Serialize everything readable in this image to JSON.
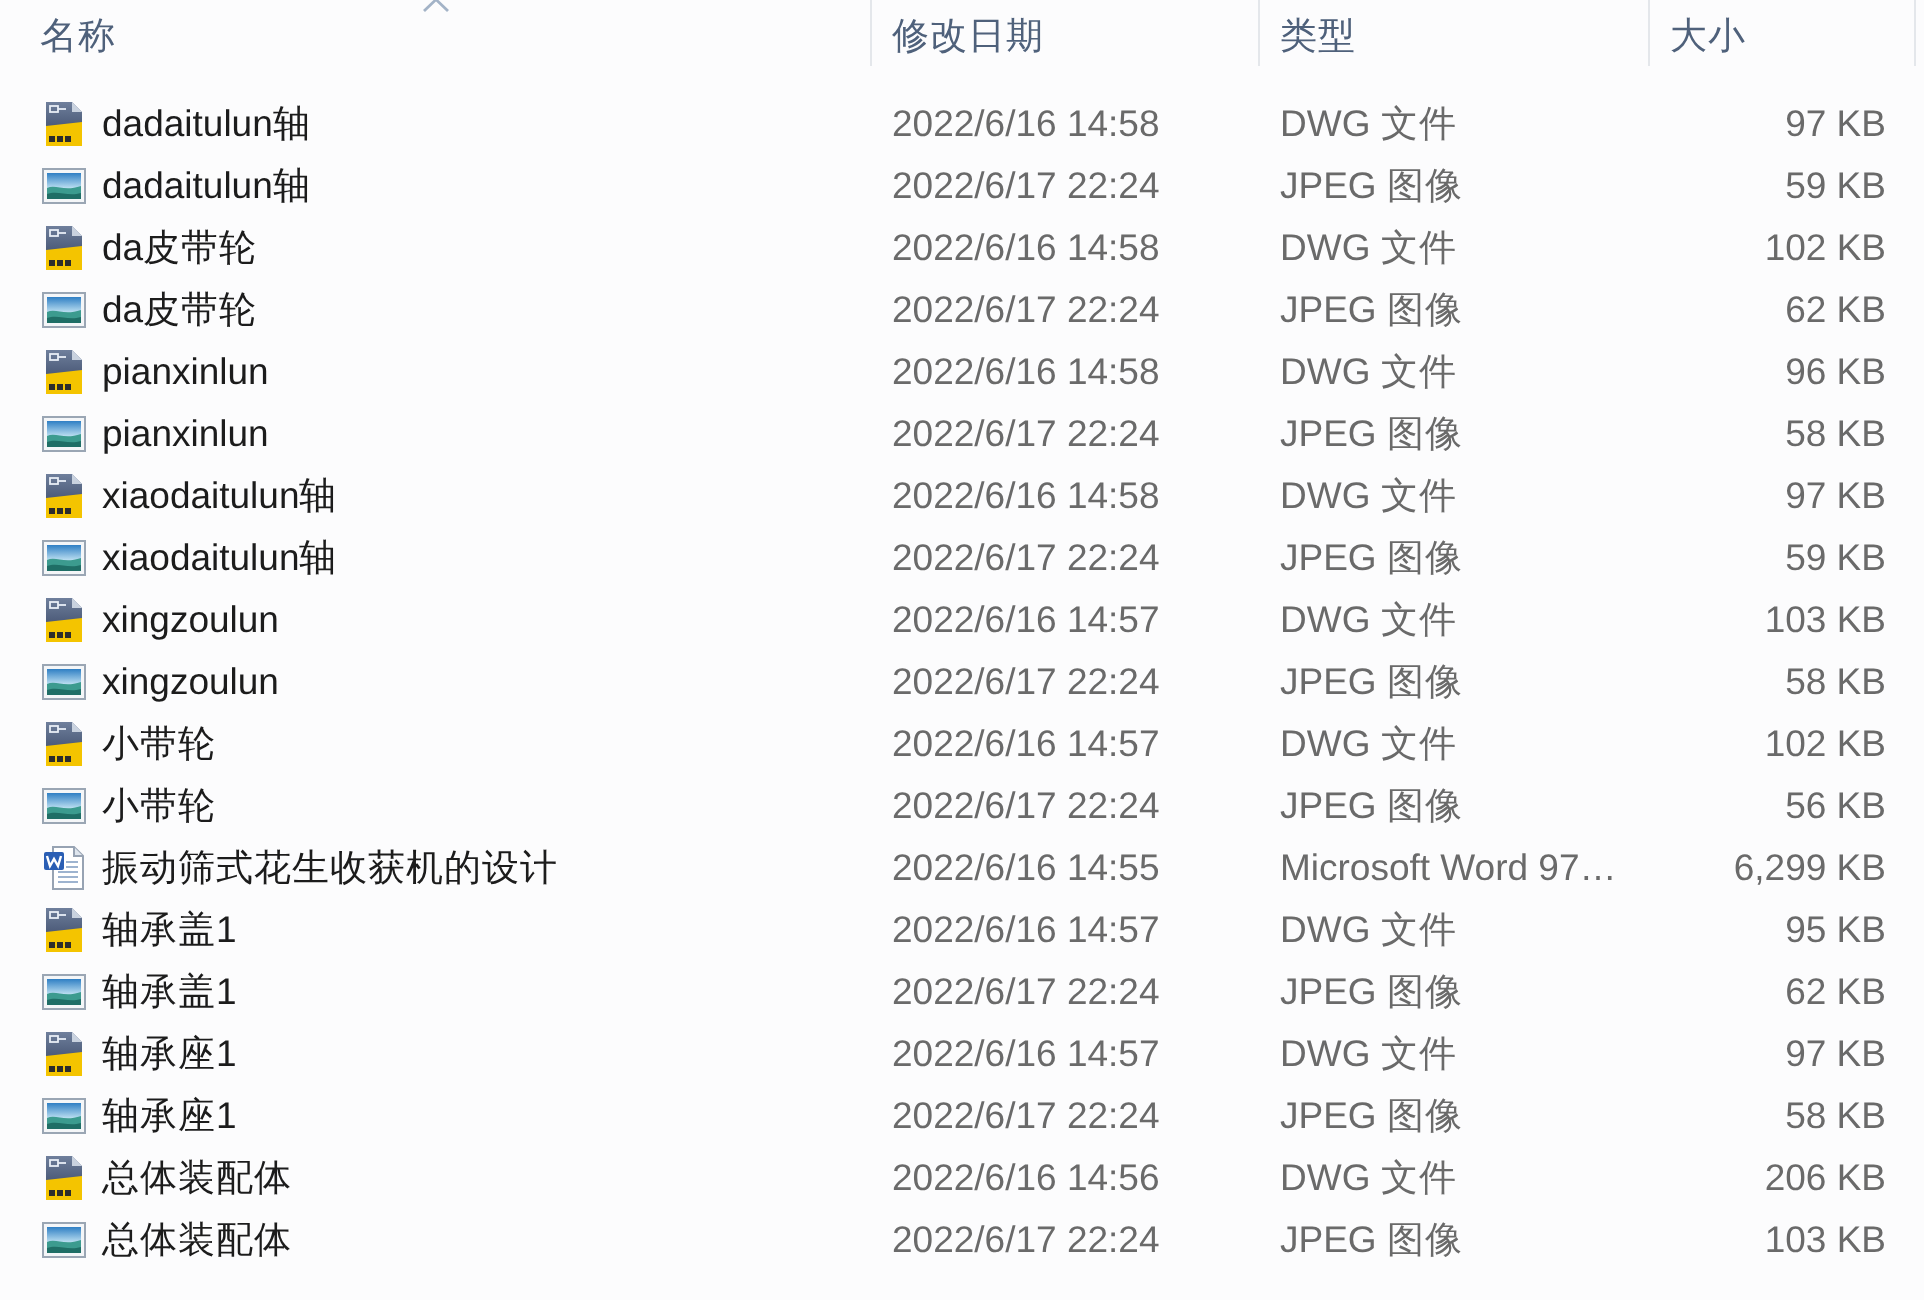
{
  "columns": [
    {
      "label": "名称",
      "sorted": true
    },
    {
      "label": "修改日期",
      "sorted": false
    },
    {
      "label": "类型",
      "sorted": false
    },
    {
      "label": "大小",
      "sorted": false
    }
  ],
  "files": [
    {
      "kind": "dwg",
      "name": "dadaitulun轴",
      "modified": "2022/6/16 14:58",
      "type": "DWG 文件",
      "size": "97 KB"
    },
    {
      "kind": "jpeg",
      "name": "dadaitulun轴",
      "modified": "2022/6/17 22:24",
      "type": "JPEG 图像",
      "size": "59 KB"
    },
    {
      "kind": "dwg",
      "name": "da皮带轮",
      "modified": "2022/6/16 14:58",
      "type": "DWG 文件",
      "size": "102 KB"
    },
    {
      "kind": "jpeg",
      "name": "da皮带轮",
      "modified": "2022/6/17 22:24",
      "type": "JPEG 图像",
      "size": "62 KB"
    },
    {
      "kind": "dwg",
      "name": "pianxinlun",
      "modified": "2022/6/16 14:58",
      "type": "DWG 文件",
      "size": "96 KB"
    },
    {
      "kind": "jpeg",
      "name": "pianxinlun",
      "modified": "2022/6/17 22:24",
      "type": "JPEG 图像",
      "size": "58 KB"
    },
    {
      "kind": "dwg",
      "name": "xiaodaitulun轴",
      "modified": "2022/6/16 14:58",
      "type": "DWG 文件",
      "size": "97 KB"
    },
    {
      "kind": "jpeg",
      "name": "xiaodaitulun轴",
      "modified": "2022/6/17 22:24",
      "type": "JPEG 图像",
      "size": "59 KB"
    },
    {
      "kind": "dwg",
      "name": "xingzoulun",
      "modified": "2022/6/16 14:57",
      "type": "DWG 文件",
      "size": "103 KB"
    },
    {
      "kind": "jpeg",
      "name": "xingzoulun",
      "modified": "2022/6/17 22:24",
      "type": "JPEG 图像",
      "size": "58 KB"
    },
    {
      "kind": "dwg",
      "name": "小带轮",
      "modified": "2022/6/16 14:57",
      "type": "DWG 文件",
      "size": "102 KB"
    },
    {
      "kind": "jpeg",
      "name": "小带轮",
      "modified": "2022/6/17 22:24",
      "type": "JPEG 图像",
      "size": "56 KB"
    },
    {
      "kind": "word",
      "name": "振动筛式花生收获机的设计",
      "modified": "2022/6/16 14:55",
      "type": "Microsoft Word 97…",
      "size": "6,299 KB"
    },
    {
      "kind": "dwg",
      "name": "轴承盖1",
      "modified": "2022/6/16 14:57",
      "type": "DWG 文件",
      "size": "95 KB"
    },
    {
      "kind": "jpeg",
      "name": "轴承盖1",
      "modified": "2022/6/17 22:24",
      "type": "JPEG 图像",
      "size": "62 KB"
    },
    {
      "kind": "dwg",
      "name": "轴承座1",
      "modified": "2022/6/16 14:57",
      "type": "DWG 文件",
      "size": "97 KB"
    },
    {
      "kind": "jpeg",
      "name": "轴承座1",
      "modified": "2022/6/17 22:24",
      "type": "JPEG 图像",
      "size": "58 KB"
    },
    {
      "kind": "dwg",
      "name": "总体装配体",
      "modified": "2022/6/16 14:56",
      "type": "DWG 文件",
      "size": "206 KB"
    },
    {
      "kind": "jpeg",
      "name": "总体装配体",
      "modified": "2022/6/17 22:24",
      "type": "JPEG 图像",
      "size": "103 KB"
    }
  ]
}
